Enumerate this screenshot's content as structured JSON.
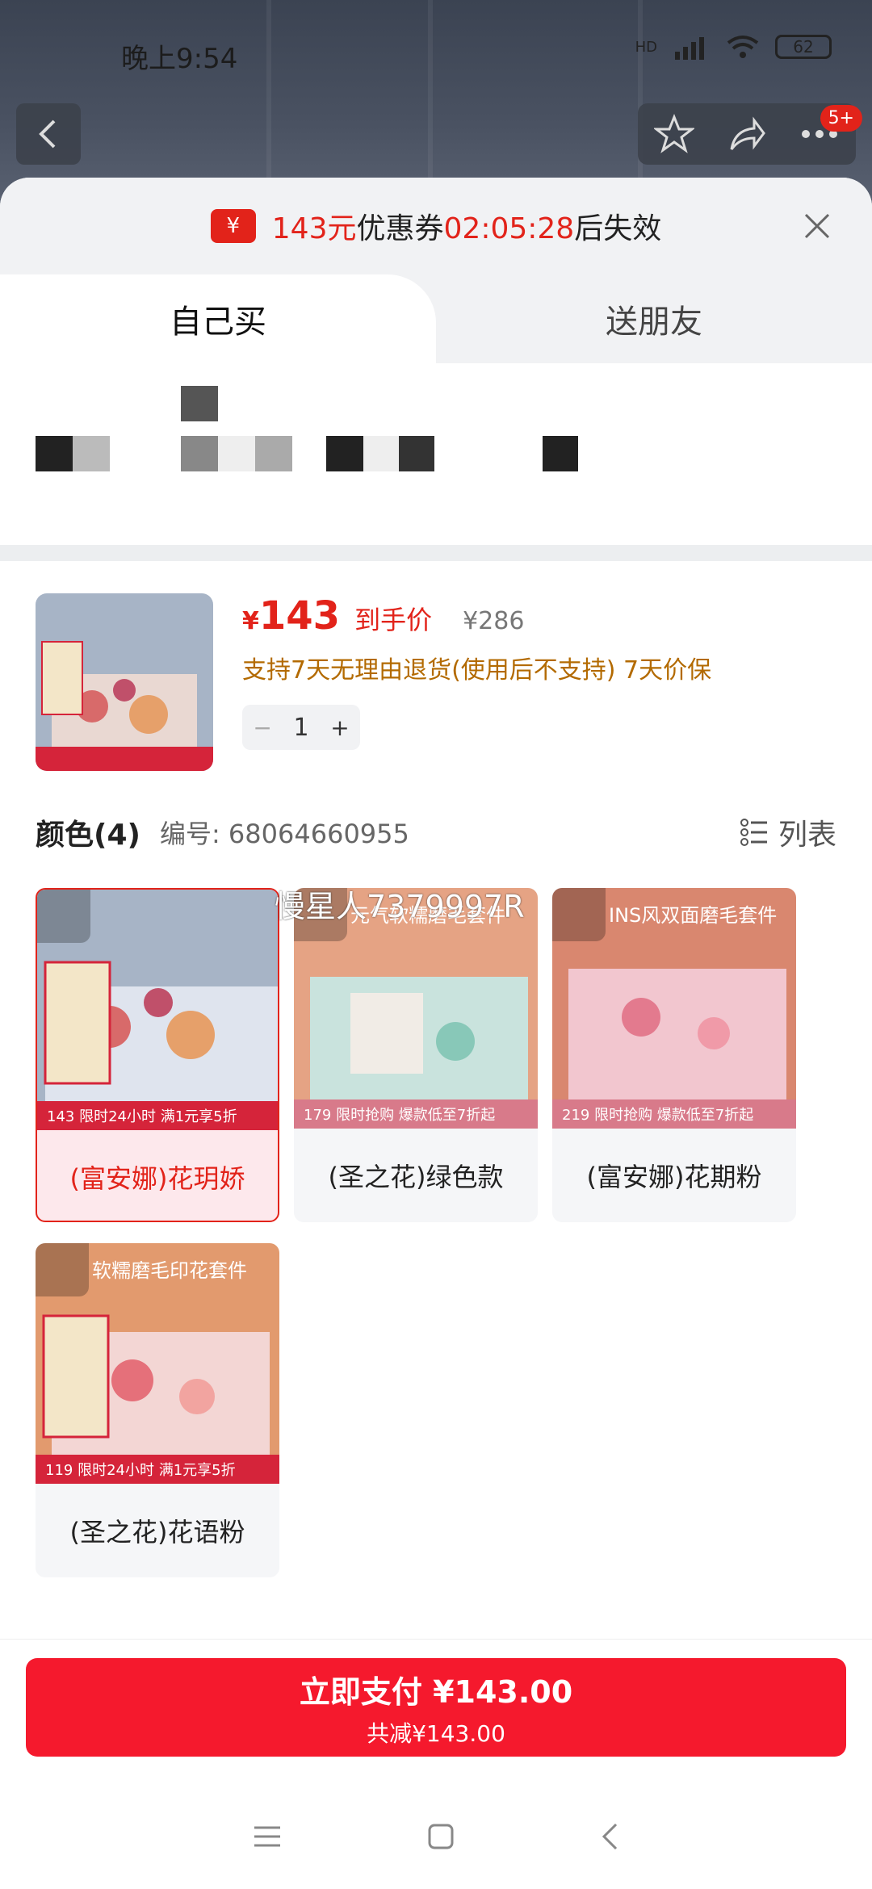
{
  "status": {
    "time": "晚上9:54",
    "network": "HD",
    "battery": "62"
  },
  "nav": {
    "badge": "5+"
  },
  "coupon": {
    "amount": "143元",
    "label": "优惠券",
    "timer": "02:05:28",
    "suffix": "后失效"
  },
  "tabs": [
    {
      "label": "自己买"
    },
    {
      "label": "送朋友"
    }
  ],
  "product": {
    "price_symbol": "¥",
    "price": "143",
    "price_tag": "到手价",
    "original_price": "¥286",
    "policy": "支持7天无理由退货(使用后不支持) 7天价保",
    "quantity": "1",
    "minus": "−",
    "plus": "+"
  },
  "color": {
    "title": "颜色(4)",
    "code": "编号: 68064660955",
    "list_label": "列表",
    "options": [
      {
        "name": "(富安娜)花玥娇",
        "overlay": "",
        "strip": "143 限时24小时 满1元享5折",
        "selected": true
      },
      {
        "name": "(圣之花)绿色款",
        "overlay": "元气软糯磨毛套件",
        "strip": "179 限时抢购 爆款低至7折起",
        "selected": false
      },
      {
        "name": "(富安娜)花期粉",
        "overlay": "INS风双面磨毛套件",
        "strip": "219 限时抢购 爆款低至7折起",
        "selected": false
      },
      {
        "name": "(圣之花)花语粉",
        "overlay": "软糯磨毛印花套件",
        "strip": "119 限时24小时 满1元享5折",
        "selected": false
      }
    ]
  },
  "watermark": "慢星人7379997R",
  "pay": {
    "main": "立即支付 ¥143.00",
    "sub": "共减¥143.00"
  },
  "colors": {
    "accent": "#e2231a",
    "pay": "#f5192d",
    "policy": "#b36a00"
  }
}
